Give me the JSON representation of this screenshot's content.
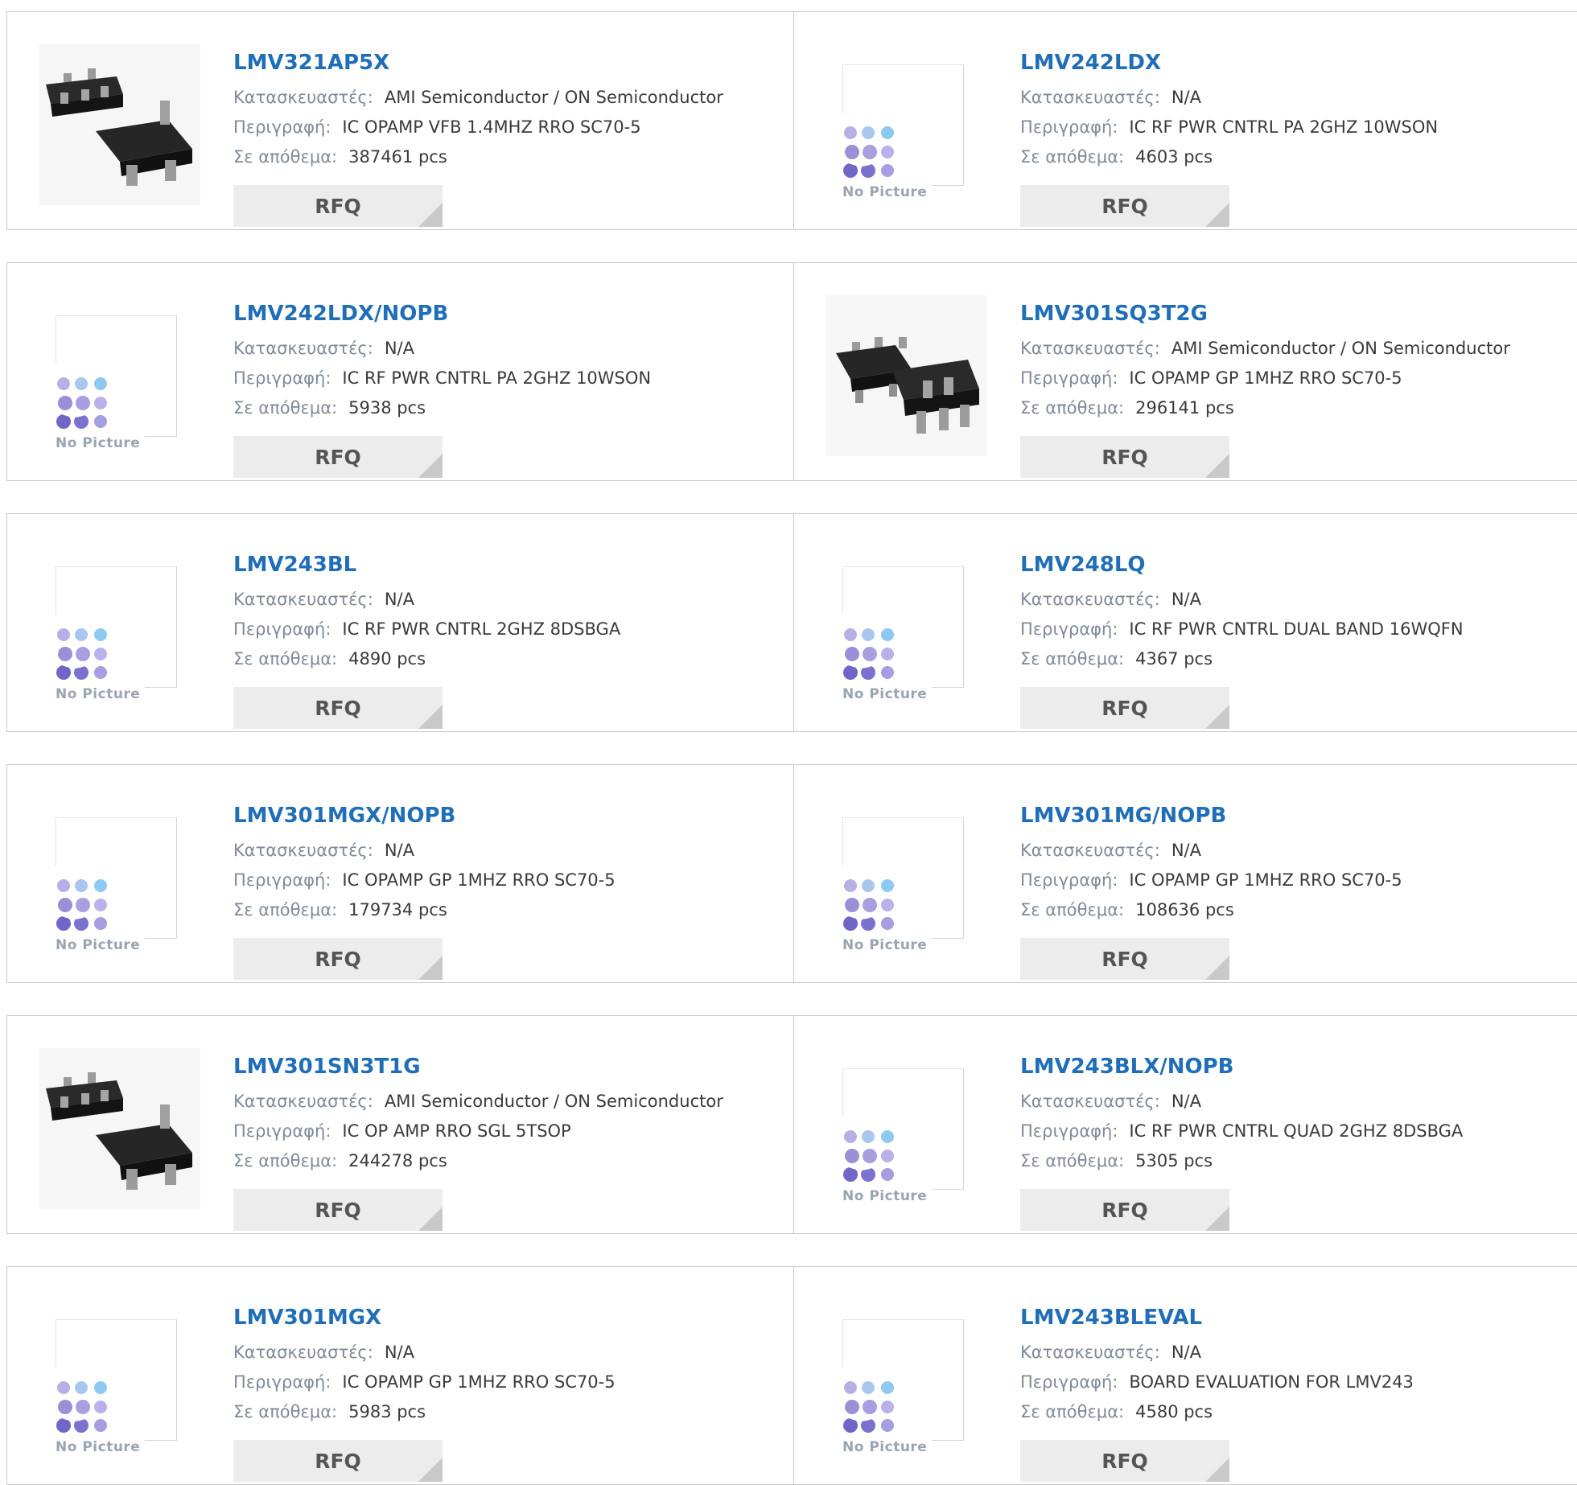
{
  "labels": {
    "manufacturer": "Κατασκευαστές:",
    "description": "Περιγραφή:",
    "stock": "Σε απόθεμα:",
    "rfq": "RFQ",
    "no_picture": "No Picture"
  },
  "colors": {
    "part_link": "#1f6eb7",
    "label": "#7f8a98",
    "rfq_bg": "#ececec"
  },
  "products": [
    {
      "part": "LMV321AP5X",
      "manufacturer": "AMI Semiconductor / ON Semiconductor",
      "description": "IC OPAMP VFB 1.4MHZ RRO SC70-5",
      "stock": "387461 pcs",
      "image": "chip-photo"
    },
    {
      "part": "LMV242LDX",
      "manufacturer": "N/A",
      "description": "IC RF PWR CNTRL PA 2GHZ 10WSON",
      "stock": "4603 pcs",
      "image": "no-picture"
    },
    {
      "part": "LMV242LDX/NOPB",
      "manufacturer": "N/A",
      "description": "IC RF PWR CNTRL PA 2GHZ 10WSON",
      "stock": "5938 pcs",
      "image": "no-picture"
    },
    {
      "part": "LMV301SQ3T2G",
      "manufacturer": "AMI Semiconductor / ON Semiconductor",
      "description": "IC OPAMP GP 1MHZ RRO SC70-5",
      "stock": "296141 pcs",
      "image": "chip-photo"
    },
    {
      "part": "LMV243BL",
      "manufacturer": "N/A",
      "description": "IC RF PWR CNTRL 2GHZ 8DSBGA",
      "stock": "4890 pcs",
      "image": "no-picture"
    },
    {
      "part": "LMV248LQ",
      "manufacturer": "N/A",
      "description": "IC RF PWR CNTRL DUAL BAND 16WQFN",
      "stock": "4367 pcs",
      "image": "no-picture"
    },
    {
      "part": "LMV301MGX/NOPB",
      "manufacturer": "N/A",
      "description": "IC OPAMP GP 1MHZ RRO SC70-5",
      "stock": "179734 pcs",
      "image": "no-picture"
    },
    {
      "part": "LMV301MG/NOPB",
      "manufacturer": "N/A",
      "description": "IC OPAMP GP 1MHZ RRO SC70-5",
      "stock": "108636 pcs",
      "image": "no-picture"
    },
    {
      "part": "LMV301SN3T1G",
      "manufacturer": "AMI Semiconductor / ON Semiconductor",
      "description": "IC OP AMP RRO SGL 5TSOP",
      "stock": "244278 pcs",
      "image": "chip-photo"
    },
    {
      "part": "LMV243BLX/NOPB",
      "manufacturer": "N/A",
      "description": "IC RF PWR CNTRL QUAD 2GHZ 8DSBGA",
      "stock": "5305 pcs",
      "image": "no-picture"
    },
    {
      "part": "LMV301MGX",
      "manufacturer": "N/A",
      "description": "IC OPAMP GP 1MHZ RRO SC70-5",
      "stock": "5983 pcs",
      "image": "no-picture"
    },
    {
      "part": "LMV243BLEVAL",
      "manufacturer": "N/A",
      "description": "BOARD EVALUATION FOR LMV243",
      "stock": "4580 pcs",
      "image": "no-picture"
    }
  ]
}
